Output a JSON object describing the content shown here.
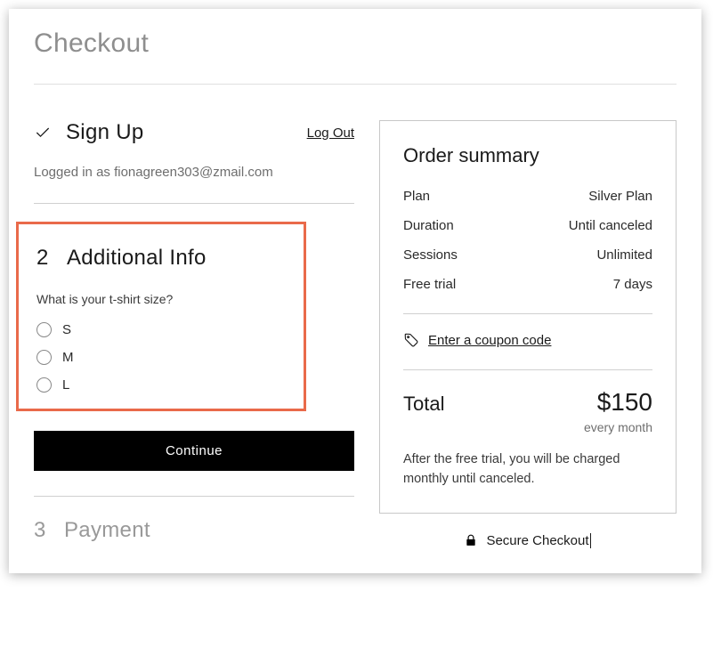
{
  "page_title": "Checkout",
  "steps": {
    "signup": {
      "title": "Sign Up",
      "logout_label": "Log Out",
      "logged_in_text": "Logged in as fionagreen303@zmail.com"
    },
    "additional": {
      "number": "2",
      "title": "Additional Info",
      "question": "What is your t-shirt size?",
      "options": [
        "S",
        "M",
        "L"
      ],
      "continue_label": "Continue"
    },
    "payment": {
      "number": "3",
      "title": "Payment"
    }
  },
  "summary": {
    "title": "Order summary",
    "rows": [
      {
        "label": "Plan",
        "value": "Silver Plan"
      },
      {
        "label": "Duration",
        "value": "Until canceled"
      },
      {
        "label": "Sessions",
        "value": "Unlimited"
      },
      {
        "label": "Free trial",
        "value": "7 days"
      }
    ],
    "coupon_label": "Enter a coupon code",
    "total_label": "Total",
    "total_amount": "$150",
    "total_freq": "every month",
    "note": "After the free trial, you will be charged monthly until canceled."
  },
  "secure_label": "Secure Checkout"
}
